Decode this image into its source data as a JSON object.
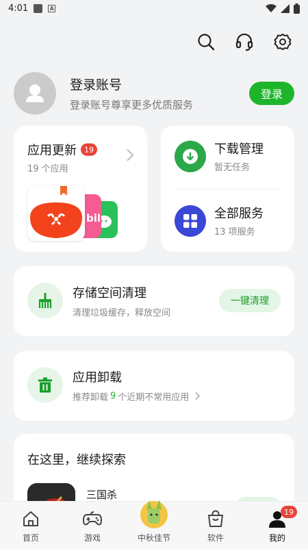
{
  "status_bar": {
    "time": "4:01"
  },
  "account": {
    "title": "登录账号",
    "subtitle": "登录账号尊享更多优质服务",
    "login_label": "登录"
  },
  "updates": {
    "title": "应用更新",
    "badge": "19",
    "subtitle": "19 个应用"
  },
  "services": [
    {
      "title": "下载管理",
      "subtitle": "暂无任务",
      "icon": "download-icon",
      "color": "#2aa84a"
    },
    {
      "title": "全部服务",
      "subtitle": "13 项服务",
      "icon": "grid-icon",
      "color": "#3b47d6"
    }
  ],
  "storage_clean": {
    "title": "存储空间清理",
    "subtitle": "清理垃圾缓存，释放空间",
    "button_label": "一键清理"
  },
  "uninstall": {
    "title": "应用卸载",
    "subtitle_prefix": "推荐卸载",
    "count": "9",
    "subtitle_suffix": "个近期不常用应用"
  },
  "explore": {
    "title": "在这里，继续探索",
    "app_name": "三国杀"
  },
  "bottom_nav": [
    {
      "label": "首页",
      "icon": "home-icon"
    },
    {
      "label": "游戏",
      "icon": "gamepad-icon"
    },
    {
      "label": "中秋佳节",
      "icon": "festival-icon"
    },
    {
      "label": "软件",
      "icon": "bag-icon"
    },
    {
      "label": "我的",
      "icon": "user-icon",
      "badge": "19"
    }
  ],
  "colors": {
    "accent_green": "#1eb52c",
    "badge_red": "#e7443a",
    "background": "#f2f3f5"
  }
}
